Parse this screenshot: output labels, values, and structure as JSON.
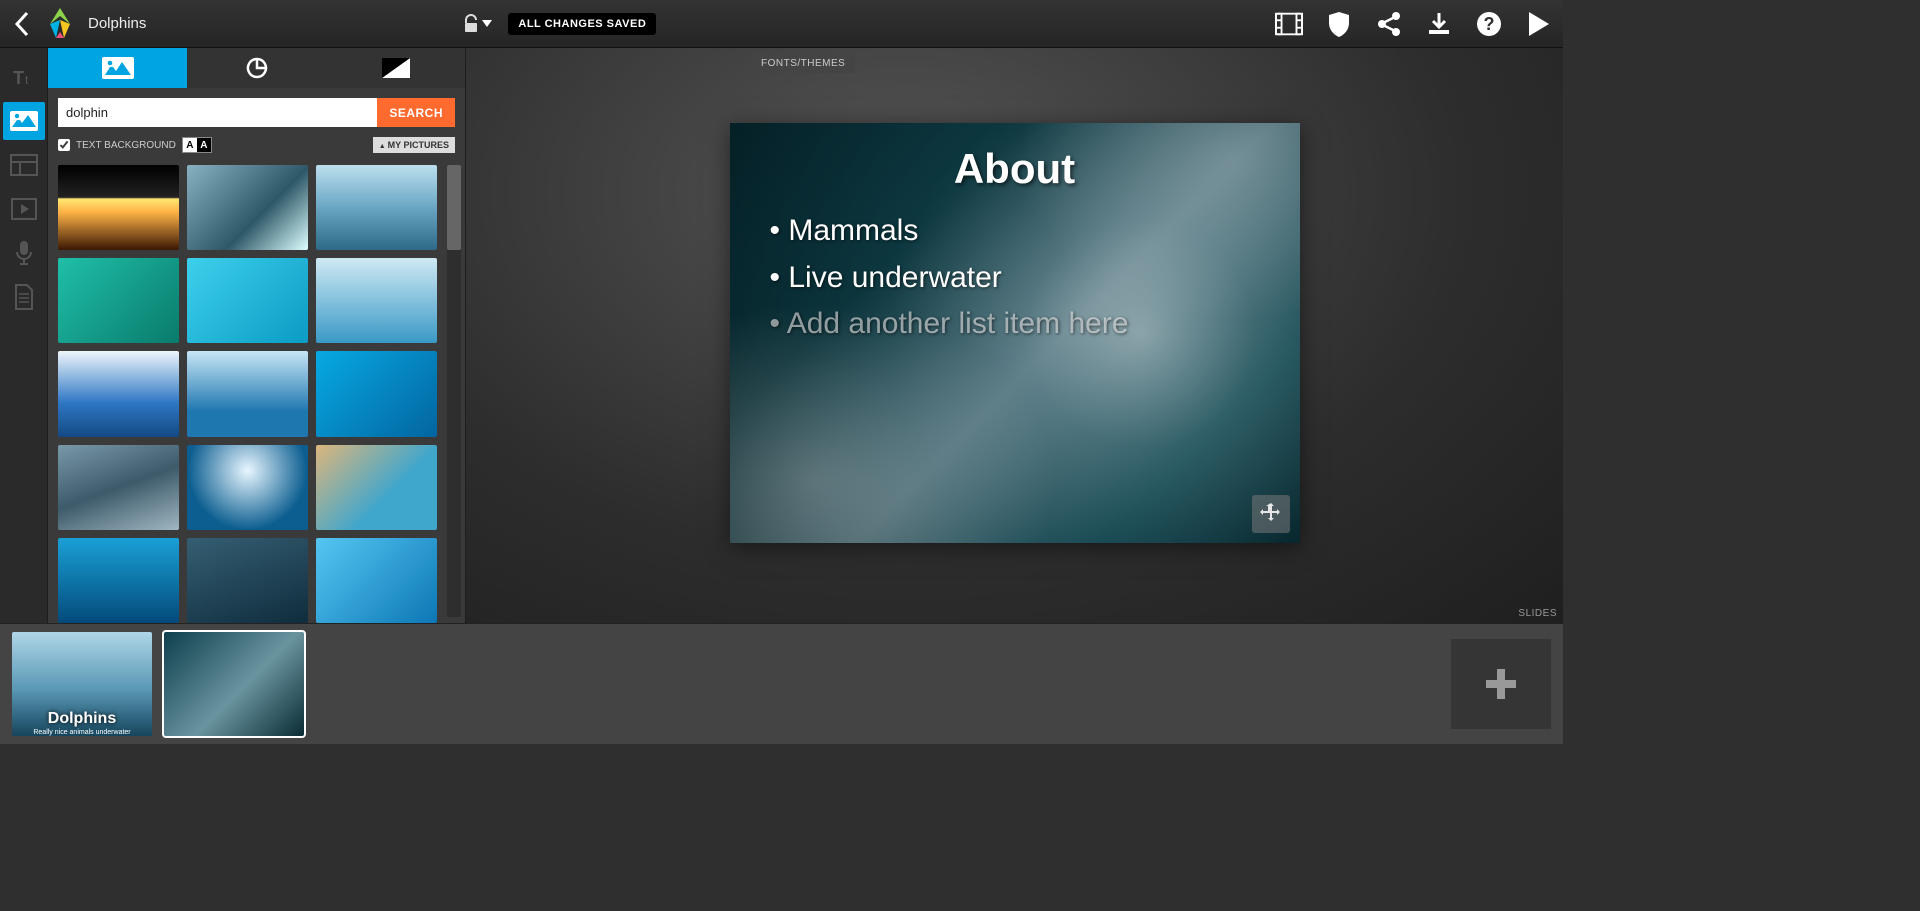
{
  "header": {
    "title": "Dolphins",
    "save_state": "ALL CHANGES SAVED",
    "tools": {
      "video": "video-icon",
      "shield": "shield-icon",
      "share": "share-icon",
      "download": "download-icon",
      "help": "help-icon",
      "play": "play-icon"
    }
  },
  "rail": {
    "items": [
      "text",
      "media",
      "layout",
      "playback",
      "audio",
      "document"
    ]
  },
  "panel": {
    "search": {
      "value": "dolphin",
      "button": "SEARCH"
    },
    "text_background_label": "TEXT BACKGROUND",
    "text_background_checked": true,
    "my_pictures_label": "MY PICTURES",
    "thumbs": [
      {
        "id": "t1"
      },
      {
        "id": "t2"
      },
      {
        "id": "t3"
      },
      {
        "id": "t4"
      },
      {
        "id": "t5"
      },
      {
        "id": "t6"
      },
      {
        "id": "t7"
      },
      {
        "id": "t8"
      },
      {
        "id": "t9"
      },
      {
        "id": "t10"
      },
      {
        "id": "t11"
      },
      {
        "id": "t12"
      },
      {
        "id": "t13"
      },
      {
        "id": "t14"
      },
      {
        "id": "t15"
      }
    ]
  },
  "canvas": {
    "fonts_themes": "FONTS/THEMES",
    "slides_label": "SLIDES",
    "slide": {
      "title": "About",
      "items": [
        "Mammals",
        "Live underwater"
      ],
      "placeholder": "Add another list item here"
    }
  },
  "tray": {
    "slides": [
      {
        "title": "Dolphins",
        "subtitle": "Really nice animals underwater",
        "selected": false
      },
      {
        "title": "",
        "subtitle": "",
        "selected": true
      }
    ]
  }
}
